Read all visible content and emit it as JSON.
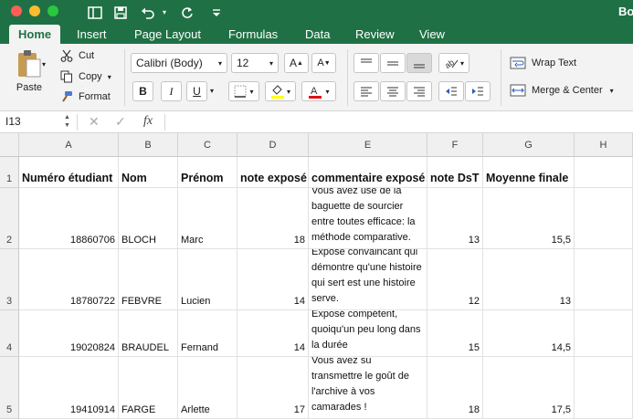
{
  "titlebar": {
    "title": "Bo"
  },
  "tabs": [
    "Home",
    "Insert",
    "Page Layout",
    "Formulas",
    "Data",
    "Review",
    "View"
  ],
  "ribbon": {
    "paste": "Paste",
    "cut": "Cut",
    "copy": "Copy",
    "format": "Format",
    "font_name": "Calibri (Body)",
    "font_size": "12",
    "bold": "B",
    "italic": "I",
    "underline": "U",
    "wrap_text": "Wrap Text",
    "merge_center": "Merge & Center"
  },
  "formula_bar": {
    "name_box": "I13",
    "fx": "fx",
    "value": ""
  },
  "columns": [
    "A",
    "B",
    "C",
    "D",
    "E",
    "F",
    "G",
    "H"
  ],
  "rows": [
    {
      "num": "1",
      "a": "Numéro étudiant",
      "b": "Nom",
      "c": "Prénom",
      "d": "note exposé",
      "e": "commentaire exposé",
      "f": "note DsT",
      "g": "Moyenne finale"
    },
    {
      "num": "2",
      "a": "18860706",
      "b": "BLOCH",
      "c": "Marc",
      "d": "18",
      "e": "Vous avez usé de la baguette de sourcier entre toutes efficace: la méthode comparative.",
      "f": "13",
      "g": "15,5"
    },
    {
      "num": "3",
      "a": "18780722",
      "b": "FEBVRE",
      "c": "Lucien",
      "d": "14",
      "e": "Exposé convaincant qui démontre qu'une histoire qui sert est une histoire serve.",
      "f": "12",
      "g": "13"
    },
    {
      "num": "4",
      "a": "19020824",
      "b": "BRAUDEL",
      "c": "Fernand",
      "d": "14",
      "e": "Exposé compétent, quoiqu'un peu long dans la durée",
      "f": "15",
      "g": "14,5"
    },
    {
      "num": "5",
      "a": "19410914",
      "b": "FARGE",
      "c": "Arlette",
      "d": "17",
      "e": "Vous avez su transmettre le goût de l'archive à vos camarades !",
      "f": "18",
      "g": "17,5"
    }
  ],
  "colors": {
    "excel_green": "#1f7145",
    "ribbon_bg": "#f3f3f3",
    "highlight_yellow": "#ffff00",
    "font_red": "#e01010"
  }
}
